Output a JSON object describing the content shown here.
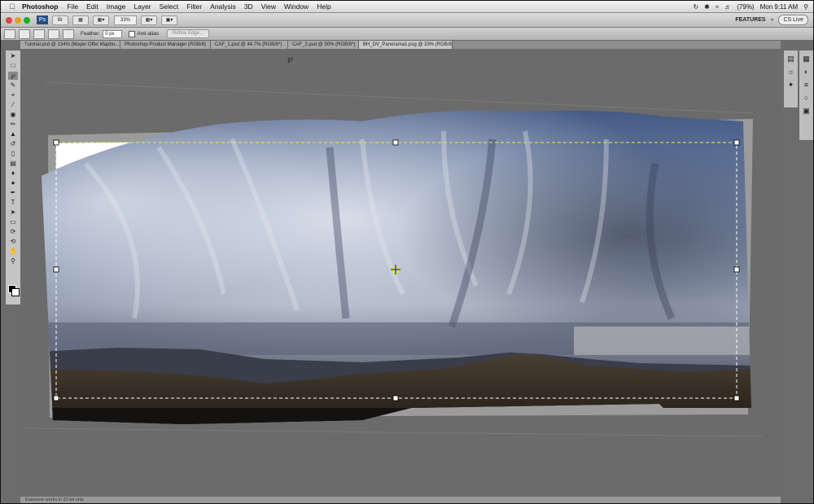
{
  "menubar": {
    "app_name": "Photoshop",
    "items": [
      "File",
      "Edit",
      "Image",
      "Layer",
      "Select",
      "Filter",
      "Analysis",
      "3D",
      "View",
      "Window",
      "Help"
    ],
    "status": {
      "battery": "(79%)",
      "clock": "Mon 9:11 AM"
    }
  },
  "appbar": {
    "zoom": "33%",
    "workspace": "FEATURES",
    "cs_live": "CS Live"
  },
  "options": {
    "feather_label": "Feather:",
    "feather_value": "0 px",
    "antialias_label": "Anti-alias",
    "refine_label": "Refine Edge..."
  },
  "tabs": [
    "Tutorial.psd @ 134% (Mayer Offer Mapbo...",
    "Photoshop Product Manager (RGB/8)",
    "CAF_1.psd @ 44.7% (RGB/8*)",
    "CAF_2.psd @ 50% (RGB/8*)",
    "BH_DV_Panorama1.psg @ 33% (RGB/8)"
  ],
  "status_text": "Exposure works in 32-bit only",
  "colors": {
    "accent": "#2c4f7c",
    "canvas_bg": "#6b6b6b",
    "sky_top": "#5b6f93",
    "sky_bright": "#d9dde6"
  }
}
